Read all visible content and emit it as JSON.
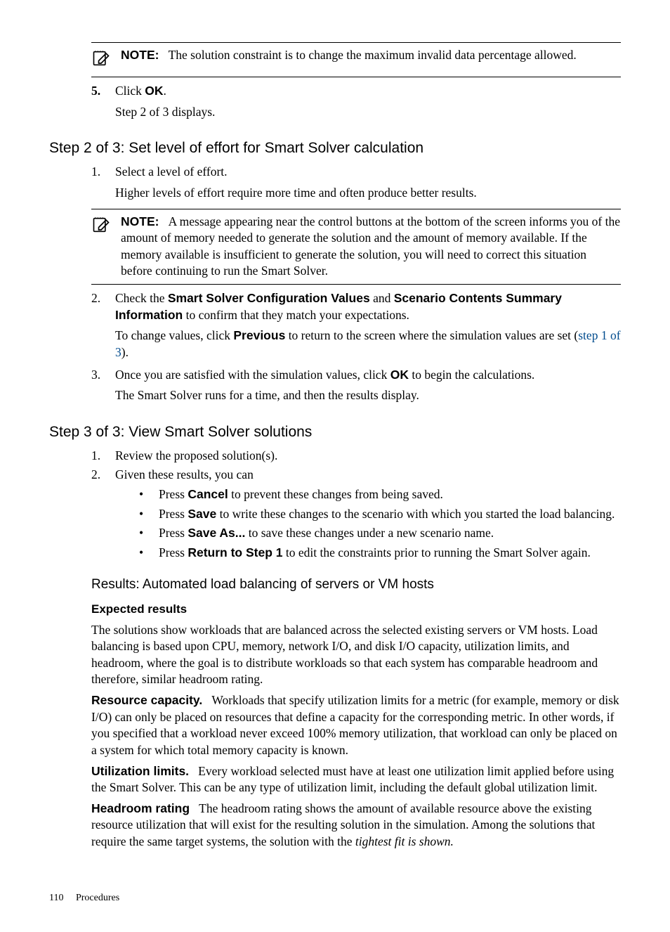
{
  "note1": {
    "label": "NOTE:",
    "text": "The solution constraint is to change the maximum invalid data percentage allowed."
  },
  "step5": {
    "num": "5.",
    "line1a": "Click ",
    "line1b": "OK",
    "line1c": ".",
    "line2": "Step 2 of 3 displays."
  },
  "h2a": "Step 2 of 3: Set level of effort for Smart Solver calculation",
  "s2_1": {
    "num": "1.",
    "line1": "Select a level of effort.",
    "line2": "Higher levels of effort require more time and often produce better results."
  },
  "note2": {
    "label": "NOTE:",
    "text": "A message appearing near the control buttons at the bottom of the screen informs you of the amount of memory needed to generate the solution and the amount of memory available. If the memory available is insufficient to generate the solution, you will need to correct this situation before continuing to run the Smart Solver."
  },
  "s2_2": {
    "num": "2.",
    "a": "Check the ",
    "b": "Smart Solver Configuration Values",
    "c": " and ",
    "d": "Scenario Contents Summary Information",
    "e": " to confirm that they match your expectations.",
    "f": "To change values, click ",
    "g": "Previous",
    "h": " to return to the screen where the simulation values are set (",
    "i": "step 1 of 3",
    "j": ")."
  },
  "s2_3": {
    "num": "3.",
    "a": "Once you are satisfied with the simulation values, click ",
    "b": "OK",
    "c": " to begin the calculations.",
    "d": "The Smart Solver runs for a time, and then the results display."
  },
  "h2b": "Step 3 of 3: View Smart Solver solutions",
  "s3_1": {
    "num": "1.",
    "text": "Review the proposed solution(s)."
  },
  "s3_2": {
    "num": "2.",
    "text": "Given these results, you can"
  },
  "bullets": {
    "dot": "•",
    "b1a": "Press ",
    "b1b": "Cancel",
    "b1c": " to prevent these changes from being saved.",
    "b2a": "Press ",
    "b2b": "Save",
    "b2c": " to write these changes to the scenario with which you started the load balancing.",
    "b3a": "Press ",
    "b3b": "Save As...",
    "b3c": " to save these changes under a new scenario name.",
    "b4a": "Press ",
    "b4b": "Return to Step 1",
    "b4c": " to edit the constraints prior to running the Smart Solver again."
  },
  "h3a": "Results: Automated load balancing of servers or VM hosts",
  "h4a": "Expected results",
  "p1": "The solutions show workloads that are balanced across the selected existing servers or VM hosts. Load balancing is based upon CPU, memory, network I/O, and disk I/O capacity, utilization limits, and headroom, where the goal is to distribute workloads so that each system has comparable headroom and therefore, similar headroom rating.",
  "p2": {
    "run": "Resource capacity.",
    "text": "Workloads that specify utilization limits for a metric (for example, memory or disk I/O) can only be placed on resources that define a capacity for the corresponding metric. In other words, if you specified that a workload never exceed 100% memory utilization, that workload can only be placed on a system for which total memory capacity is known."
  },
  "p3": {
    "run": "Utilization limits.",
    "text": "Every workload selected must have at least one utilization limit applied before using the Smart Solver. This can be any type of utilization limit, including the default global utilization limit."
  },
  "p4": {
    "run": "Headroom rating",
    "a": "The headroom rating shows the amount of available resource above the existing resource utilization that will exist for the resulting solution in the simulation. Among the solutions that require the same target systems, the solution with the ",
    "b": "tightest fit is shown."
  },
  "footer": {
    "page": "110",
    "section": "Procedures"
  }
}
